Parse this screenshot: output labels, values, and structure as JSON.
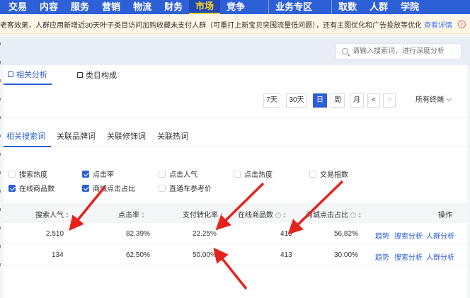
{
  "nav": {
    "items": [
      "交易",
      "内容",
      "服务",
      "营销",
      "物流",
      "财务",
      "市场",
      "竞争",
      "业务专区",
      "取数",
      "人群",
      "学院"
    ],
    "active": "市场"
  },
  "notice": {
    "text": "老客效果，人群应用新增近30天叶子类目访问加购收藏未支付人群（可重打上新宝贝突围流量低问题），还有主图优化和广告投放等优化策略！",
    "link": "查看详情"
  },
  "search": {
    "placeholder": "请输入搜索词，进行深度分析"
  },
  "tabs": {
    "related_analysis": "相关分析",
    "category_structure": "类目构成"
  },
  "time_filter": {
    "options": [
      "7天",
      "30天",
      "日",
      "周",
      "月"
    ],
    "active": "日",
    "prev": "<",
    "next": ">",
    "terminal": "所有终端"
  },
  "subtabs": [
    "相关搜索词",
    "关联品牌词",
    "关联修饰词",
    "关联热词"
  ],
  "metrics": [
    {
      "label": "搜索热度",
      "checked": false
    },
    {
      "label": "点击率",
      "checked": true
    },
    {
      "label": "点击人气",
      "checked": false
    },
    {
      "label": "点击热度",
      "checked": false
    },
    {
      "label": "交易指数",
      "checked": false
    },
    {
      "label": "在线商品数",
      "checked": true
    },
    {
      "label": "商城点击占比",
      "checked": true
    },
    {
      "label": "直通车参考价",
      "checked": false
    }
  ],
  "table": {
    "headers": [
      "搜索人气",
      "点击率",
      "支付转化率",
      "在线商品数",
      "商城点击占比",
      "操作"
    ],
    "rows": [
      {
        "search_popularity": "2,510",
        "click_rate": "82.39%",
        "pay_conversion": "22.25%",
        "online_items": "415",
        "mall_click_ratio": "56.82%"
      },
      {
        "search_popularity": "134",
        "click_rate": "62.50%",
        "pay_conversion": "50.00%",
        "online_items": "413",
        "mall_click_ratio": "30.00%"
      }
    ],
    "actions": [
      "趋势",
      "搜索分析",
      "人群分析"
    ]
  },
  "colors": {
    "brand": "#2d5fd6",
    "arrow": "#e5231c",
    "active_nav_text": "#ffd21e"
  }
}
